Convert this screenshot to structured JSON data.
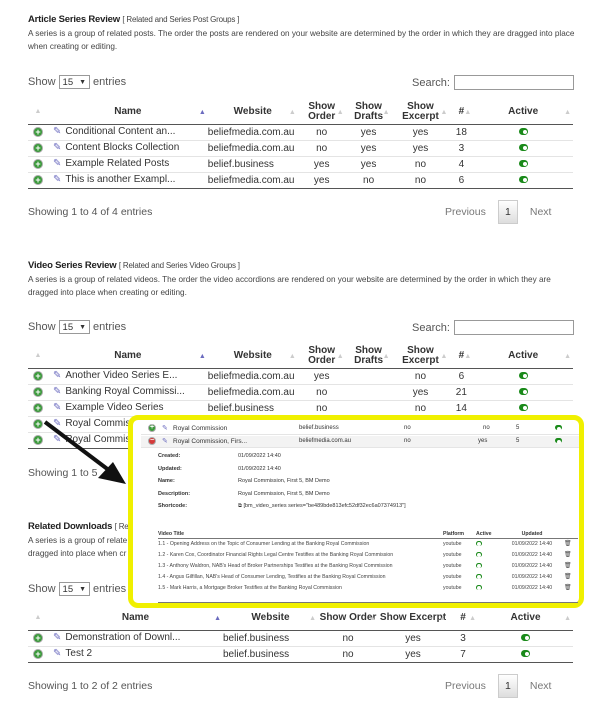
{
  "columns_full": [
    "Name",
    "Website",
    "Show Order",
    "Show Drafts",
    "Show Excerpt",
    "#",
    "Active"
  ],
  "show_label": "Show",
  "entries_label": "entries",
  "page_length": "15",
  "search_label": "Search:",
  "previous": "Previous",
  "next": "Next",
  "page": "1",
  "article": {
    "title": "Article Series Review",
    "subtitle": "[ Related and Series Post Groups ]",
    "description": "A series is a group of related posts. The order the posts are rendered on your website are determined by the order in which they are dragged into place when creating or editing.",
    "rows": [
      [
        "Conditional Content an...",
        "beliefmedia.com.au",
        "no",
        "yes",
        "yes",
        "18"
      ],
      [
        "Content Blocks Collection",
        "beliefmedia.com.au",
        "no",
        "yes",
        "yes",
        "3"
      ],
      [
        "Example Related Posts",
        "belief.business",
        "yes",
        "yes",
        "no",
        "4"
      ],
      [
        "This is another Exampl...",
        "beliefmedia.com.au",
        "yes",
        "no",
        "no",
        "6"
      ]
    ],
    "info": "Showing 1 to 4 of 4 entries"
  },
  "video": {
    "title": "Video Series Review",
    "subtitle": "[ Related and Series Video Groups ]",
    "description": "A series is a group of related videos. The order the video accordions are rendered on your website are determined by the order in which they are dragged into place when creating or editing.",
    "rows": [
      [
        "Another Video Series E...",
        "beliefmedia.com.au",
        "yes",
        "",
        "no",
        "6"
      ],
      [
        "Banking Royal Commissi...",
        "beliefmedia.com.au",
        "no",
        "",
        "yes",
        "21"
      ],
      [
        "Example Video Series",
        "belief.business",
        "no",
        "",
        "no",
        "14"
      ],
      [
        "Royal Commiss",
        "",
        "",
        "",
        "",
        ""
      ],
      [
        "Royal Commiss",
        "",
        "",
        "",
        "",
        ""
      ]
    ],
    "info": "Showing 1 to 5"
  },
  "downloads": {
    "title": "Related Downloads",
    "subtitle": "[ Re",
    "description": "A series is a group of relate",
    "description2": "dragged into place when cr",
    "columns": [
      "Name",
      "Website",
      "Show Order",
      "Show Excerpt",
      "#",
      "Active"
    ],
    "rows": [
      [
        "Demonstration of Downl...",
        "belief.business",
        "no",
        "yes",
        "3"
      ],
      [
        "Test 2",
        "belief.business",
        "no",
        "yes",
        "7"
      ]
    ],
    "info": "Showing 1 to 2 of 2 entries"
  },
  "popup": {
    "highlight_color": "#f0f000",
    "rows": [
      [
        "Royal Commission",
        "belief.business",
        "no",
        "no",
        "5"
      ],
      [
        "Royal Commission, Firs...",
        "beliefmedia.com.au",
        "no",
        "yes",
        "5"
      ]
    ],
    "details": [
      [
        "Created:",
        "01/09/2022 14:40"
      ],
      [
        "Updated:",
        "01/09/2022 14:40"
      ],
      [
        "Name:",
        "Royal Commission, First 5, BM Demo"
      ],
      [
        "Description:",
        "Royal Commission, First 5, BM Demo"
      ],
      [
        "Shortcode:",
        "[bm_video_series series=\"be489bde813efc52df32ec6a07374913\"]"
      ]
    ],
    "video_columns": [
      "Video Title",
      "Platform",
      "Active",
      "Updated"
    ],
    "videos": [
      [
        "1.1 - Opening Address on the Topic of Consumer Lending at the Banking Royal Commission",
        "youtube",
        "01/09/2022 14:40"
      ],
      [
        "1.2 - Karen Cox, Coordinator Financial Rights Legal Centre Testifies at the Banking Royal Commission",
        "youtube",
        "01/09/2022 14:40"
      ],
      [
        "1.3 - Anthony Waldron, NAB's Head of Broker Partnerships Testifies at the Banking Royal Commission",
        "youtube",
        "01/09/2022 14:40"
      ],
      [
        "1.4 - Angus Gilfillan, NAB's Head of Consumer Lending, Testifies at the Banking Royal Commission",
        "youtube",
        "01/09/2022 14:40"
      ],
      [
        "1.5 - Mark Harris, a Mortgage Broker Testifies at the Banking Royal Commission",
        "youtube",
        "01/09/2022 14:40"
      ]
    ]
  }
}
